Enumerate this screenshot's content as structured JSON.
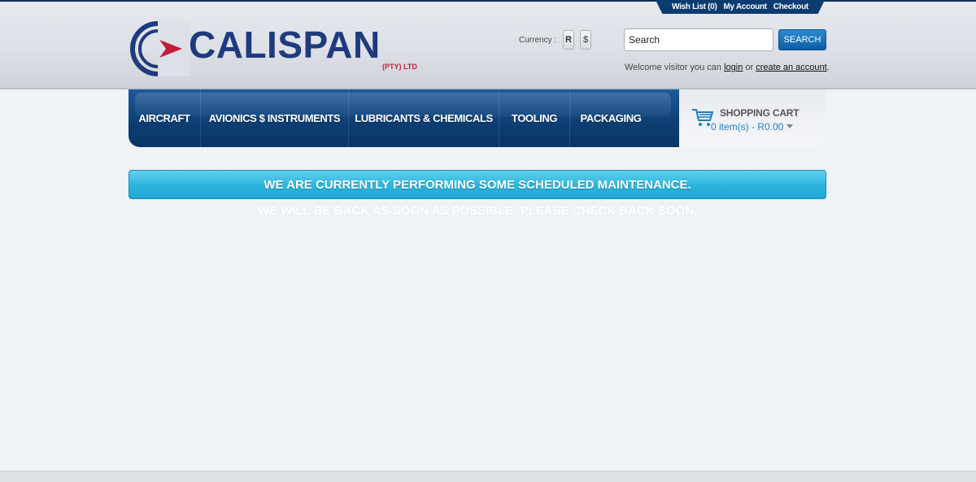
{
  "header": {
    "top_links": {
      "wishlist": "Wish List (0)",
      "account": "My Account",
      "checkout": "Checkout"
    },
    "logo": {
      "name": "CALISPAN",
      "sub": "(PTY) LTD",
      "brand_blue": "#1f3a7d",
      "brand_red": "#c21d3a"
    },
    "currency": {
      "label": "Currency :",
      "options": [
        "R",
        "$"
      ]
    },
    "search": {
      "value": "Search",
      "button": "SEARCH"
    },
    "welcome": {
      "prefix": "Welcome visitor you can",
      "login": "login",
      "or": "or",
      "create": "create an account",
      "suffix": "."
    }
  },
  "nav": {
    "items": [
      {
        "label": "AIRCRAFT"
      },
      {
        "label": "AVIONICS $ INSTRUMENTS"
      },
      {
        "label": "LUBRICANTS & CHEMICALS"
      },
      {
        "label": "TOOLING"
      },
      {
        "label": "PACKAGING"
      }
    ]
  },
  "cart": {
    "title": "SHOPPING CART",
    "total": "0 item(s) - R0.00",
    "icon": "shopping-cart-icon"
  },
  "main": {
    "banner": "WE ARE CURRENTLY PERFORMING SOME SCHEDULED MAINTENANCE.",
    "subtext": "WE WILL BE BACK AS SOON AS POSSIBLE. PLEASE CHECK BACK SOON."
  },
  "colors": {
    "nav_blue": "#0d3f75",
    "banner_cyan": "#2fb6de",
    "link_blue": "#1e7fc3"
  }
}
